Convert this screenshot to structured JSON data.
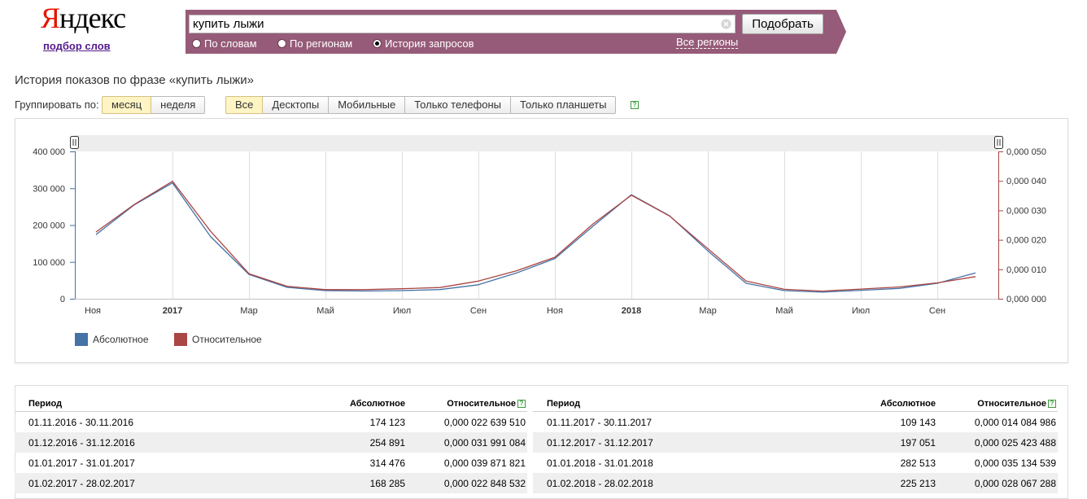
{
  "header": {
    "logo_ya": "Я",
    "logo_rest": "ндекс",
    "logo_sub": "подбор слов"
  },
  "search": {
    "query": "купить лыжи",
    "button_label": "Подобрать",
    "modes": [
      {
        "label": "По словам",
        "selected": false
      },
      {
        "label": "По регионам",
        "selected": false
      },
      {
        "label": "История запросов",
        "selected": true
      }
    ],
    "regions_link": "Все регионы"
  },
  "filters": {
    "title": "История показов по фразе «купить лыжи»",
    "group_by_label": "Группировать по:",
    "group_by": [
      {
        "label": "месяц",
        "active": true
      },
      {
        "label": "неделя",
        "active": false
      }
    ],
    "devices": [
      {
        "label": "Все",
        "active": true
      },
      {
        "label": "Десктопы",
        "active": false
      },
      {
        "label": "Мобильные",
        "active": false
      },
      {
        "label": "Только телефоны",
        "active": false
      },
      {
        "label": "Только планшеты",
        "active": false
      }
    ]
  },
  "colors": {
    "brand_bar": "#965b78",
    "absolute": "#4572a7",
    "relative": "#aa4643",
    "yandex_red": "#e61400"
  },
  "chart_data": {
    "type": "line",
    "x": [
      "2016-11",
      "2016-12",
      "2017-01",
      "2017-02",
      "2017-03",
      "2017-04",
      "2017-05",
      "2017-06",
      "2017-07",
      "2017-08",
      "2017-09",
      "2017-10",
      "2017-11",
      "2017-12",
      "2018-01",
      "2018-02",
      "2018-03",
      "2018-04",
      "2018-05",
      "2018-06",
      "2018-07",
      "2018-08",
      "2018-09",
      "2018-10"
    ],
    "x_tick_labels": [
      "Ноя",
      "2017",
      "Мар",
      "Май",
      "Июл",
      "Сен",
      "Ноя",
      "2018",
      "Мар",
      "Май",
      "Июл",
      "Сен"
    ],
    "series": [
      {
        "name": "Абсолютное",
        "axis": "left",
        "values": [
          174123,
          254891,
          314476,
          168285,
          66000,
          31000,
          22000,
          21000,
          22000,
          25000,
          38000,
          70000,
          109143,
          197051,
          282513,
          225213,
          130000,
          42000,
          22000,
          18000,
          23000,
          28000,
          42000,
          70000
        ]
      },
      {
        "name": "Относительное",
        "axis": "right",
        "values": [
          2.263951e-05,
          3.1991084e-05,
          3.9871821e-05,
          2.2848532e-05,
          8.5e-06,
          4.2e-06,
          3.1e-06,
          3.1e-06,
          3.4e-06,
          3.8e-06,
          6e-06,
          9.5e-06,
          1.4084986e-05,
          2.5423488e-05,
          3.5134539e-05,
          2.8067288e-05,
          1.7e-05,
          6e-06,
          3.2e-06,
          2.6e-06,
          3.3e-06,
          4e-06,
          5.4e-06,
          7.5e-06
        ]
      }
    ],
    "y_left": {
      "ylim": [
        0,
        400000
      ],
      "ticks": [
        "0",
        "100 000",
        "200 000",
        "300 000",
        "400 000"
      ]
    },
    "y_right": {
      "ylim": [
        0,
        5e-05
      ],
      "ticks": [
        "0,000 000",
        "0,000 010",
        "0,000 020",
        "0,000 030",
        "0,000 040",
        "0,000 050"
      ]
    },
    "legend": [
      "Абсолютное",
      "Относительное"
    ],
    "legend_placement": "bottom-left",
    "grid": true
  },
  "table": {
    "headers": [
      "Период",
      "Абсолютное",
      "Относительное"
    ],
    "left_rows": [
      [
        "01.11.2016 - 30.11.2016",
        "174 123",
        "0,000 022 639 510"
      ],
      [
        "01.12.2016 - 31.12.2016",
        "254 891",
        "0,000 031 991 084"
      ],
      [
        "01.01.2017 - 31.01.2017",
        "314 476",
        "0,000 039 871 821"
      ],
      [
        "01.02.2017 - 28.02.2017",
        "168 285",
        "0,000 022 848 532"
      ]
    ],
    "right_rows": [
      [
        "01.11.2017 - 30.11.2017",
        "109 143",
        "0,000 014 084 986"
      ],
      [
        "01.12.2017 - 31.12.2017",
        "197 051",
        "0,000 025 423 488"
      ],
      [
        "01.01.2018 - 31.01.2018",
        "282 513",
        "0,000 035 134 539"
      ],
      [
        "01.02.2018 - 28.02.2018",
        "225 213",
        "0,000 028 067 288"
      ]
    ]
  }
}
